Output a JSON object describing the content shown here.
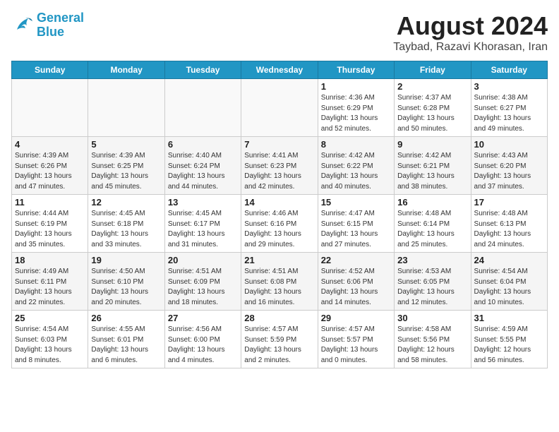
{
  "header": {
    "logo_line1": "General",
    "logo_line2": "Blue",
    "month_year": "August 2024",
    "location": "Taybad, Razavi Khorasan, Iran"
  },
  "weekdays": [
    "Sunday",
    "Monday",
    "Tuesday",
    "Wednesday",
    "Thursday",
    "Friday",
    "Saturday"
  ],
  "weeks": [
    [
      {
        "day": "",
        "info": ""
      },
      {
        "day": "",
        "info": ""
      },
      {
        "day": "",
        "info": ""
      },
      {
        "day": "",
        "info": ""
      },
      {
        "day": "1",
        "info": "Sunrise: 4:36 AM\nSunset: 6:29 PM\nDaylight: 13 hours\nand 52 minutes."
      },
      {
        "day": "2",
        "info": "Sunrise: 4:37 AM\nSunset: 6:28 PM\nDaylight: 13 hours\nand 50 minutes."
      },
      {
        "day": "3",
        "info": "Sunrise: 4:38 AM\nSunset: 6:27 PM\nDaylight: 13 hours\nand 49 minutes."
      }
    ],
    [
      {
        "day": "4",
        "info": "Sunrise: 4:39 AM\nSunset: 6:26 PM\nDaylight: 13 hours\nand 47 minutes."
      },
      {
        "day": "5",
        "info": "Sunrise: 4:39 AM\nSunset: 6:25 PM\nDaylight: 13 hours\nand 45 minutes."
      },
      {
        "day": "6",
        "info": "Sunrise: 4:40 AM\nSunset: 6:24 PM\nDaylight: 13 hours\nand 44 minutes."
      },
      {
        "day": "7",
        "info": "Sunrise: 4:41 AM\nSunset: 6:23 PM\nDaylight: 13 hours\nand 42 minutes."
      },
      {
        "day": "8",
        "info": "Sunrise: 4:42 AM\nSunset: 6:22 PM\nDaylight: 13 hours\nand 40 minutes."
      },
      {
        "day": "9",
        "info": "Sunrise: 4:42 AM\nSunset: 6:21 PM\nDaylight: 13 hours\nand 38 minutes."
      },
      {
        "day": "10",
        "info": "Sunrise: 4:43 AM\nSunset: 6:20 PM\nDaylight: 13 hours\nand 37 minutes."
      }
    ],
    [
      {
        "day": "11",
        "info": "Sunrise: 4:44 AM\nSunset: 6:19 PM\nDaylight: 13 hours\nand 35 minutes."
      },
      {
        "day": "12",
        "info": "Sunrise: 4:45 AM\nSunset: 6:18 PM\nDaylight: 13 hours\nand 33 minutes."
      },
      {
        "day": "13",
        "info": "Sunrise: 4:45 AM\nSunset: 6:17 PM\nDaylight: 13 hours\nand 31 minutes."
      },
      {
        "day": "14",
        "info": "Sunrise: 4:46 AM\nSunset: 6:16 PM\nDaylight: 13 hours\nand 29 minutes."
      },
      {
        "day": "15",
        "info": "Sunrise: 4:47 AM\nSunset: 6:15 PM\nDaylight: 13 hours\nand 27 minutes."
      },
      {
        "day": "16",
        "info": "Sunrise: 4:48 AM\nSunset: 6:14 PM\nDaylight: 13 hours\nand 25 minutes."
      },
      {
        "day": "17",
        "info": "Sunrise: 4:48 AM\nSunset: 6:13 PM\nDaylight: 13 hours\nand 24 minutes."
      }
    ],
    [
      {
        "day": "18",
        "info": "Sunrise: 4:49 AM\nSunset: 6:11 PM\nDaylight: 13 hours\nand 22 minutes."
      },
      {
        "day": "19",
        "info": "Sunrise: 4:50 AM\nSunset: 6:10 PM\nDaylight: 13 hours\nand 20 minutes."
      },
      {
        "day": "20",
        "info": "Sunrise: 4:51 AM\nSunset: 6:09 PM\nDaylight: 13 hours\nand 18 minutes."
      },
      {
        "day": "21",
        "info": "Sunrise: 4:51 AM\nSunset: 6:08 PM\nDaylight: 13 hours\nand 16 minutes."
      },
      {
        "day": "22",
        "info": "Sunrise: 4:52 AM\nSunset: 6:06 PM\nDaylight: 13 hours\nand 14 minutes."
      },
      {
        "day": "23",
        "info": "Sunrise: 4:53 AM\nSunset: 6:05 PM\nDaylight: 13 hours\nand 12 minutes."
      },
      {
        "day": "24",
        "info": "Sunrise: 4:54 AM\nSunset: 6:04 PM\nDaylight: 13 hours\nand 10 minutes."
      }
    ],
    [
      {
        "day": "25",
        "info": "Sunrise: 4:54 AM\nSunset: 6:03 PM\nDaylight: 13 hours\nand 8 minutes."
      },
      {
        "day": "26",
        "info": "Sunrise: 4:55 AM\nSunset: 6:01 PM\nDaylight: 13 hours\nand 6 minutes."
      },
      {
        "day": "27",
        "info": "Sunrise: 4:56 AM\nSunset: 6:00 PM\nDaylight: 13 hours\nand 4 minutes."
      },
      {
        "day": "28",
        "info": "Sunrise: 4:57 AM\nSunset: 5:59 PM\nDaylight: 13 hours\nand 2 minutes."
      },
      {
        "day": "29",
        "info": "Sunrise: 4:57 AM\nSunset: 5:57 PM\nDaylight: 13 hours\nand 0 minutes."
      },
      {
        "day": "30",
        "info": "Sunrise: 4:58 AM\nSunset: 5:56 PM\nDaylight: 12 hours\nand 58 minutes."
      },
      {
        "day": "31",
        "info": "Sunrise: 4:59 AM\nSunset: 5:55 PM\nDaylight: 12 hours\nand 56 minutes."
      }
    ]
  ]
}
